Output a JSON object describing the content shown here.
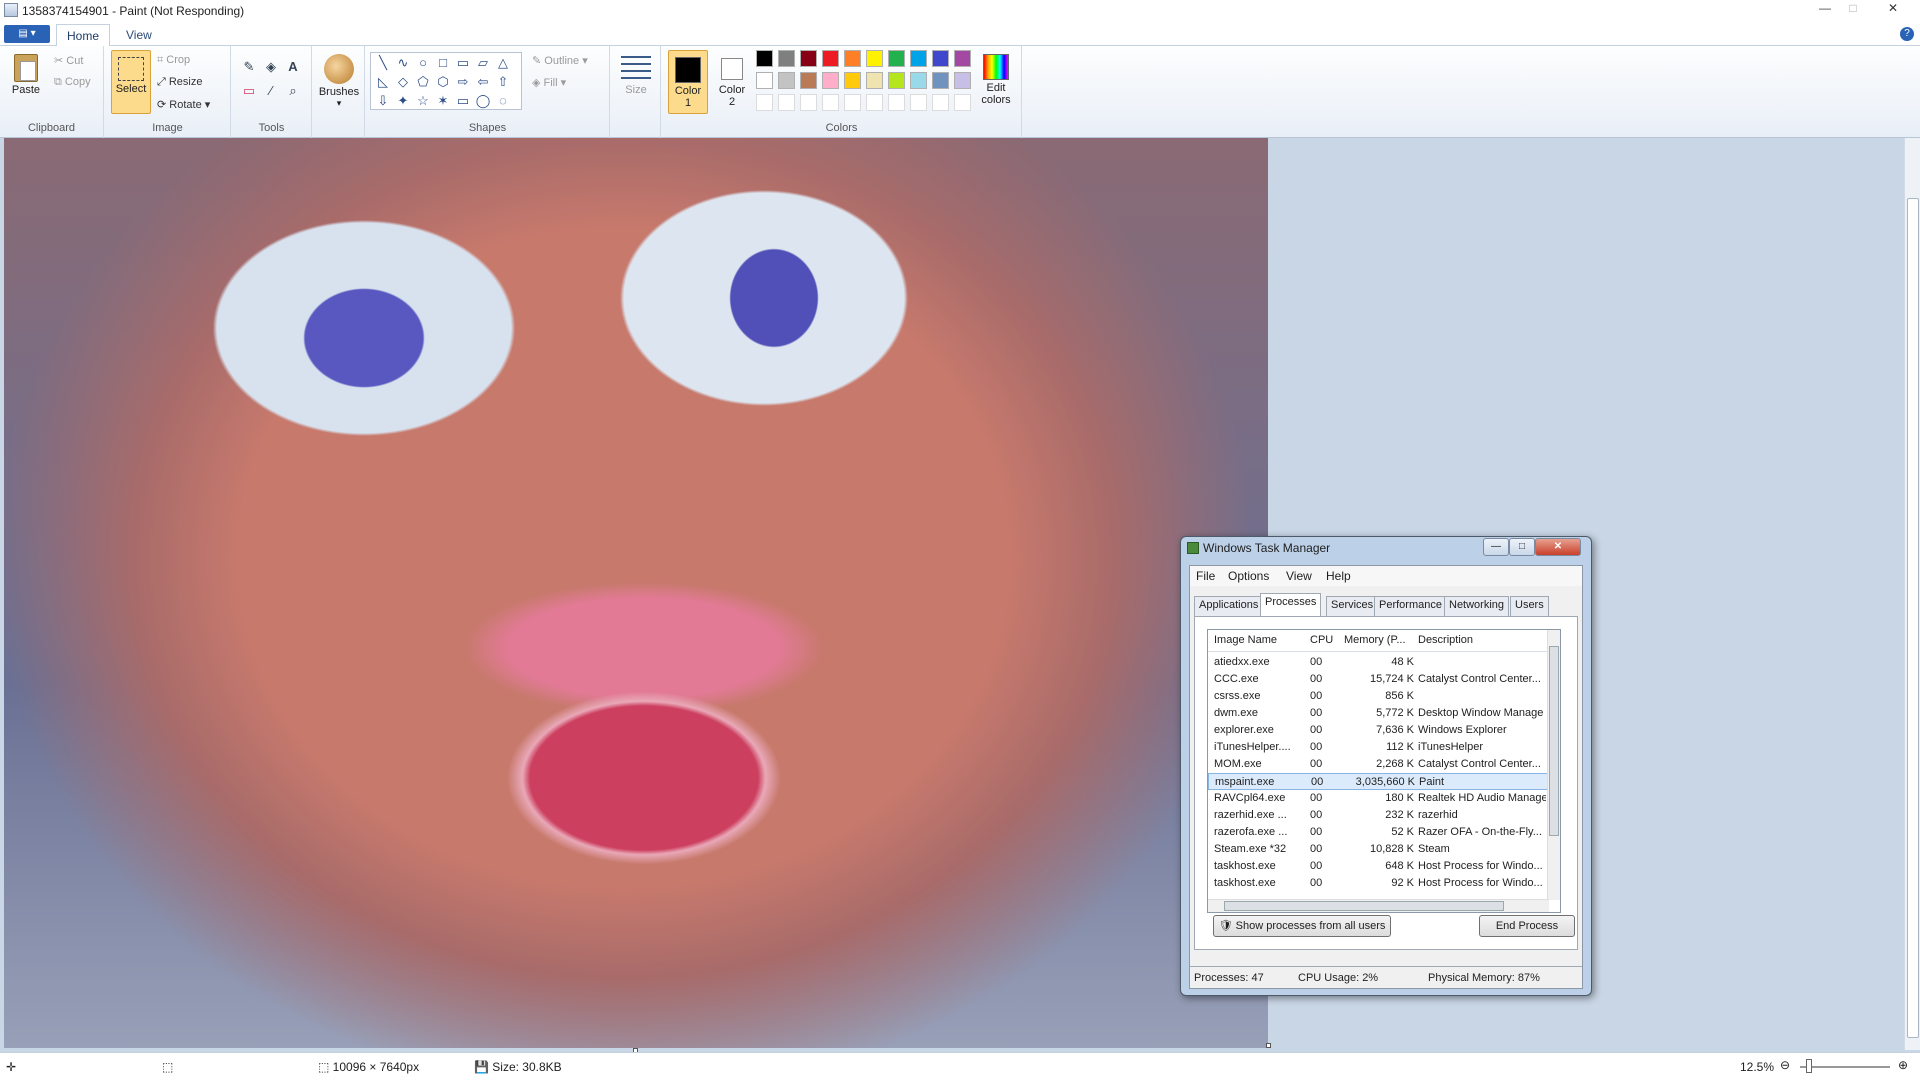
{
  "window": {
    "title": "1358374154901 - Paint (Not Responding)",
    "min": "—",
    "max": "□",
    "close": "✕"
  },
  "ribbon_tabs": {
    "app_menu": "▤ ▾",
    "home": "Home",
    "view": "View",
    "help": "?"
  },
  "clipboard": {
    "paste": "Paste",
    "cut": "Cut",
    "copy": "Copy",
    "label": "Clipboard"
  },
  "image": {
    "select": "Select",
    "crop": "Crop",
    "resize": "Resize",
    "rotate": "Rotate",
    "label": "Image"
  },
  "tools": {
    "label": "Tools",
    "pencil": "✎",
    "fill": "◈",
    "text": "A",
    "eraser": "▭",
    "picker": "⁄",
    "magnifier": "⌕"
  },
  "brushes": {
    "label": "Brushes"
  },
  "shapes": {
    "label": "Shapes",
    "outline": "Outline",
    "fill": "Fill",
    "glyphs": [
      "╲",
      "∿",
      "○",
      "□",
      "▭",
      "▱",
      "△",
      "◺",
      "◇",
      "⬠",
      "⬡",
      "⇨",
      "⇦",
      "⇧",
      "⇩",
      "✦",
      "☆",
      "✶",
      "▭",
      "◯",
      "◌"
    ]
  },
  "size": {
    "label": "Size"
  },
  "colors": {
    "label": "Colors",
    "color1_label": "Color",
    "color1_num": "1",
    "color2_label": "Color",
    "color2_num": "2",
    "edit_colors_1": "Edit",
    "edit_colors_2": "colors",
    "palette": [
      "#000000",
      "#7f7f7f",
      "#880015",
      "#ed1c24",
      "#ff7f27",
      "#fff200",
      "#22b14c",
      "#00a2e8",
      "#3f48cc",
      "#a349a4",
      "#ffffff",
      "#c3c3c3",
      "#b97a57",
      "#ffaec9",
      "#ffc90e",
      "#efe4b0",
      "#b5e61d",
      "#99d9ea",
      "#7092be",
      "#c8bfe7"
    ],
    "color1": "#000000",
    "color2": "#ffffff"
  },
  "status": {
    "dimensions": "10096 × 7640px",
    "size": "Size: 30.8KB",
    "zoom": "12.5%",
    "zoom_minus": "⊖",
    "zoom_plus": "⊕"
  },
  "taskmgr": {
    "title": "Windows Task Manager",
    "menu": [
      "File",
      "Options",
      "View",
      "Help"
    ],
    "tabs": [
      "Applications",
      "Processes",
      "Services",
      "Performance",
      "Networking",
      "Users"
    ],
    "columns": [
      "Image Name",
      "CPU",
      "Memory (P...",
      "Description"
    ],
    "rows": [
      [
        "atiedxx.exe",
        "00",
        "48 K",
        ""
      ],
      [
        "CCC.exe",
        "00",
        "15,724 K",
        "Catalyst Control Center..."
      ],
      [
        "csrss.exe",
        "00",
        "856 K",
        ""
      ],
      [
        "dwm.exe",
        "00",
        "5,772 K",
        "Desktop Window Manage"
      ],
      [
        "explorer.exe",
        "00",
        "7,636 K",
        "Windows Explorer"
      ],
      [
        "iTunesHelper....",
        "00",
        "112 K",
        "iTunesHelper"
      ],
      [
        "MOM.exe",
        "00",
        "2,268 K",
        "Catalyst Control Center..."
      ],
      [
        "mspaint.exe",
        "00",
        "3,035,660 K",
        "Paint"
      ],
      [
        "RAVCpl64.exe",
        "00",
        "180 K",
        "Realtek HD Audio Manage"
      ],
      [
        "razerhid.exe ...",
        "00",
        "232 K",
        "razerhid"
      ],
      [
        "razerofa.exe ...",
        "00",
        "52 K",
        "Razer OFA - On-the-Fly..."
      ],
      [
        "Steam.exe *32",
        "00",
        "10,828 K",
        "Steam"
      ],
      [
        "taskhost.exe",
        "00",
        "648 K",
        "Host Process for Windo..."
      ],
      [
        "taskhost.exe",
        "00",
        "92 K",
        "Host Process for Windo..."
      ]
    ],
    "selected_row": 7,
    "show_all": "Show processes from all users",
    "end_process": "End Process",
    "status_processes": "Processes: 47",
    "status_cpu": "CPU Usage: 2%",
    "status_memory": "Physical Memory: 87%"
  }
}
